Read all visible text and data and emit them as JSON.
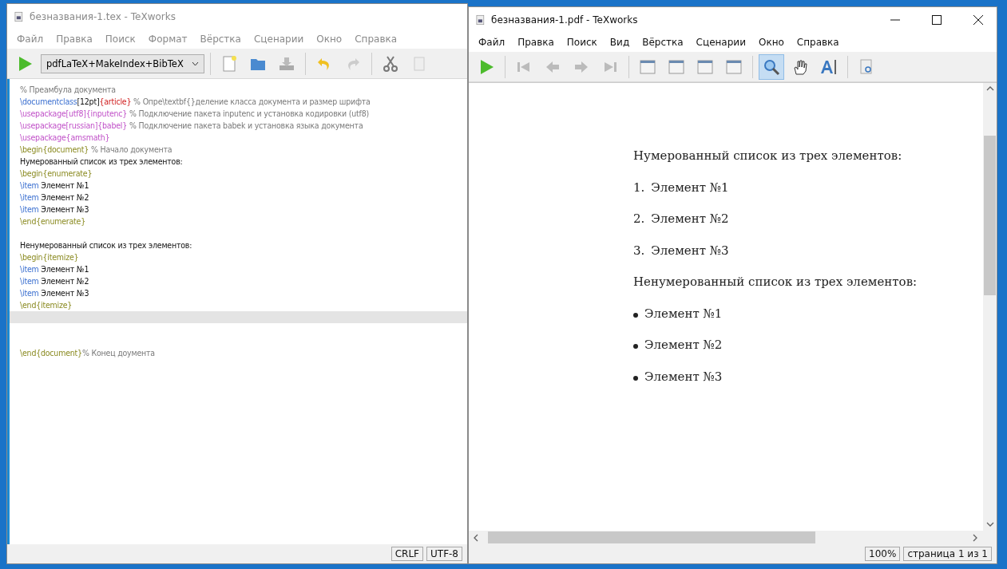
{
  "editor": {
    "title": "безназвания-1.tex - TeXworks",
    "active": false,
    "menu": [
      "Файл",
      "Правка",
      "Поиск",
      "Формат",
      "Вёрстка",
      "Сценарии",
      "Окно",
      "Справка"
    ],
    "engine": "pdfLaTeX+MakeIndex+BibTeX",
    "lines": [
      {
        "current": false,
        "segments": [
          {
            "kind": "comment",
            "text": "% Преамбула документа"
          }
        ]
      },
      {
        "current": false,
        "segments": [
          {
            "kind": "keyword",
            "text": "\\documentclass"
          },
          {
            "kind": "plain",
            "text": "[12pt]"
          },
          {
            "kind": "brace",
            "text": "{article}"
          },
          {
            "kind": "comment",
            "text": " % Опре\\textbf{}деление класса документа и размер шрифта"
          }
        ]
      },
      {
        "current": false,
        "segments": [
          {
            "kind": "package",
            "text": "\\usepackage[utf8]{inputenc}"
          },
          {
            "kind": "comment",
            "text": " % Подключение пакета inputenc и установка кодировки (utf8)"
          }
        ]
      },
      {
        "current": false,
        "segments": [
          {
            "kind": "package",
            "text": "\\usepackage[russian]{babel}"
          },
          {
            "kind": "comment",
            "text": " % Подключение пакета babek и установка языка документа"
          }
        ]
      },
      {
        "current": false,
        "segments": [
          {
            "kind": "package",
            "text": "\\usepackage{amsmath}"
          }
        ]
      },
      {
        "current": false,
        "segments": [
          {
            "kind": "env",
            "text": "\\begin{document}"
          },
          {
            "kind": "comment",
            "text": " % Начало документа"
          }
        ]
      },
      {
        "current": false,
        "segments": [
          {
            "kind": "plain",
            "text": "Нумерованный список из трех элементов:"
          }
        ]
      },
      {
        "current": false,
        "segments": [
          {
            "kind": "env",
            "text": "\\begin{enumerate}"
          }
        ]
      },
      {
        "current": false,
        "segments": [
          {
            "kind": "keyword",
            "text": "\\item"
          },
          {
            "kind": "plain",
            "text": " Элемент №1"
          }
        ]
      },
      {
        "current": false,
        "segments": [
          {
            "kind": "keyword",
            "text": "\\item"
          },
          {
            "kind": "plain",
            "text": " Элемент №2"
          }
        ]
      },
      {
        "current": false,
        "segments": [
          {
            "kind": "keyword",
            "text": "\\item"
          },
          {
            "kind": "plain",
            "text": " Элемент №3"
          }
        ]
      },
      {
        "current": false,
        "segments": [
          {
            "kind": "env",
            "text": "\\end{enumerate}"
          }
        ]
      },
      {
        "current": false
      },
      {
        "current": false,
        "segments": [
          {
            "kind": "plain",
            "text": "Ненумерованный список из трех элементов:"
          }
        ]
      },
      {
        "current": false,
        "segments": [
          {
            "kind": "env",
            "text": "\\begin{itemize}"
          }
        ]
      },
      {
        "current": false,
        "segments": [
          {
            "kind": "keyword",
            "text": "\\item"
          },
          {
            "kind": "plain",
            "text": " Элемент №1"
          }
        ]
      },
      {
        "current": false,
        "segments": [
          {
            "kind": "keyword",
            "text": "\\item"
          },
          {
            "kind": "plain",
            "text": " Элемент №2"
          }
        ]
      },
      {
        "current": false,
        "segments": [
          {
            "kind": "keyword",
            "text": "\\item"
          },
          {
            "kind": "plain",
            "text": " Элемент №3"
          }
        ]
      },
      {
        "current": false,
        "segments": [
          {
            "kind": "env",
            "text": "\\end{itemize}"
          }
        ]
      },
      {
        "current": true
      },
      {
        "current": false
      },
      {
        "current": false
      },
      {
        "current": false,
        "segments": [
          {
            "kind": "env",
            "text": "\\end{document}"
          },
          {
            "kind": "comment",
            "text": "% Конец доумента"
          }
        ]
      }
    ],
    "status": [
      "CRLF",
      "UTF-8"
    ]
  },
  "viewer": {
    "title": "безназвания-1.pdf - TeXworks",
    "active": true,
    "menu": [
      "Файл",
      "Правка",
      "Поиск",
      "Вид",
      "Вёрстка",
      "Сценарии",
      "Окно",
      "Справка"
    ],
    "tools": [
      {
        "kind": "magnifier",
        "selected": true
      },
      {
        "kind": "hand",
        "selected": false
      },
      {
        "kind": "text",
        "selected": false
      }
    ],
    "page": [
      {
        "kind": "heading",
        "text": "Нумерованный список из трех элементов:"
      },
      {
        "kind": "numbered",
        "marker": "1.",
        "text": "Элемент №1"
      },
      {
        "kind": "numbered",
        "marker": "2.",
        "text": "Элемент №2"
      },
      {
        "kind": "numbered",
        "marker": "3.",
        "text": "Элемент №3"
      },
      {
        "kind": "heading",
        "text": "Ненумерованный список из трех элементов:"
      },
      {
        "kind": "bullet",
        "text": "Элемент №1"
      },
      {
        "kind": "bullet",
        "text": "Элемент №2"
      },
      {
        "kind": "bullet",
        "text": "Элемент №3"
      }
    ],
    "status": [
      "100%",
      "страница 1 из 1"
    ]
  }
}
